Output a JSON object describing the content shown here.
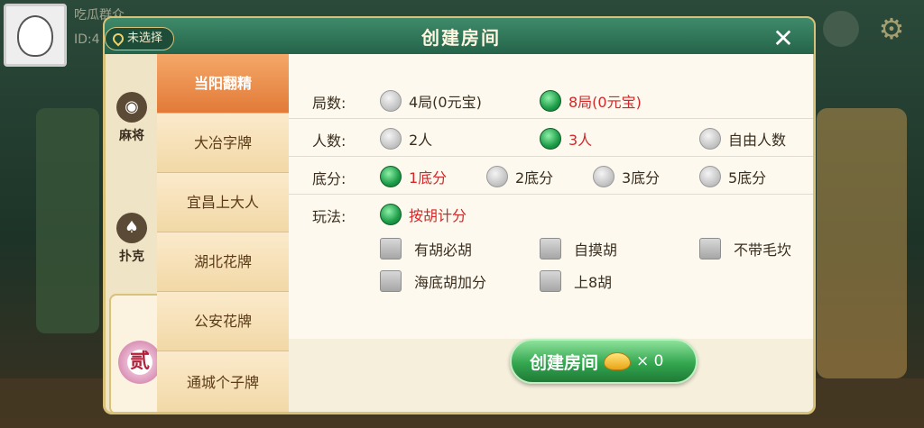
{
  "player": {
    "name": "吃瓜群众",
    "id_prefix": "ID:4"
  },
  "dialog": {
    "title": "创建房间",
    "location": "未选择",
    "close_glyph": "✕"
  },
  "categories": [
    {
      "label": "麻将",
      "icon": "mahjong-tile-icon"
    },
    {
      "label": "扑克",
      "icon": "spade-icon"
    },
    {
      "label": "贰",
      "icon": "er-badge-icon"
    }
  ],
  "games": [
    "当阳翻精",
    "大冶字牌",
    "宜昌上大人",
    "湖北花牌",
    "公安花牌",
    "通城个子牌"
  ],
  "active_game": "当阳翻精",
  "settings": {
    "rounds": {
      "label": "局数:",
      "options": [
        "4局(0元宝)",
        "8局(0元宝)"
      ],
      "selected": "8局(0元宝)"
    },
    "players": {
      "label": "人数:",
      "options": [
        "2人",
        "3人",
        "自由人数"
      ],
      "selected": "3人"
    },
    "base": {
      "label": "底分:",
      "options": [
        "1底分",
        "2底分",
        "3底分",
        "5底分"
      ],
      "selected": "1底分"
    },
    "play": {
      "label": "玩法:",
      "options": [
        "按胡计分"
      ],
      "selected": "按胡计分"
    },
    "extras": [
      {
        "label": "有胡必胡",
        "checked": false
      },
      {
        "label": "自摸胡",
        "checked": false
      },
      {
        "label": "不带毛坎",
        "checked": false
      },
      {
        "label": "海底胡加分",
        "checked": false
      },
      {
        "label": "上8胡",
        "checked": false
      }
    ]
  },
  "create_button": {
    "label": "创建房间",
    "cost": "× 0"
  },
  "colors": {
    "selected_text": "#d2282a",
    "accent_green": "#33a650",
    "gold_border": "#d8c27a"
  }
}
